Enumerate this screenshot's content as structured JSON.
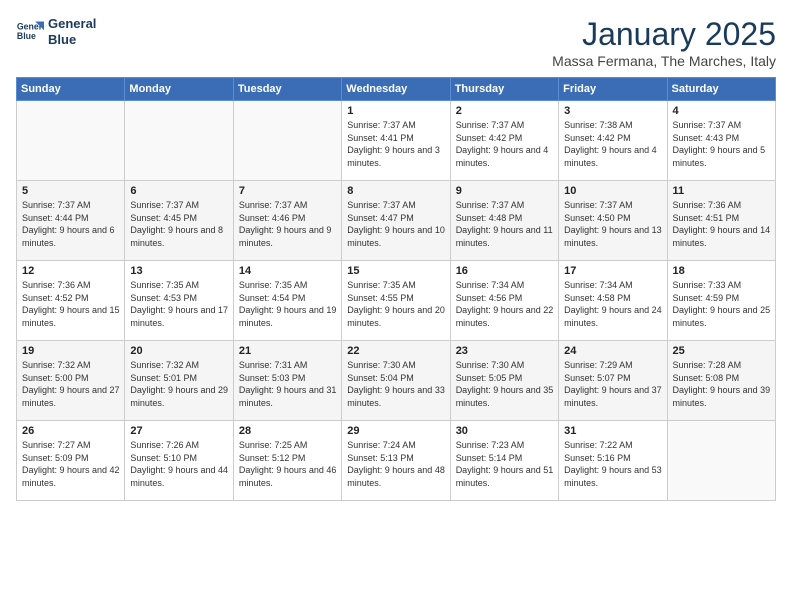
{
  "header": {
    "logo_line1": "General",
    "logo_line2": "Blue",
    "month": "January 2025",
    "location": "Massa Fermana, The Marches, Italy"
  },
  "weekdays": [
    "Sunday",
    "Monday",
    "Tuesday",
    "Wednesday",
    "Thursday",
    "Friday",
    "Saturday"
  ],
  "weeks": [
    [
      {
        "day": "",
        "info": ""
      },
      {
        "day": "",
        "info": ""
      },
      {
        "day": "",
        "info": ""
      },
      {
        "day": "1",
        "info": "Sunrise: 7:37 AM\nSunset: 4:41 PM\nDaylight: 9 hours and 3 minutes."
      },
      {
        "day": "2",
        "info": "Sunrise: 7:37 AM\nSunset: 4:42 PM\nDaylight: 9 hours and 4 minutes."
      },
      {
        "day": "3",
        "info": "Sunrise: 7:38 AM\nSunset: 4:42 PM\nDaylight: 9 hours and 4 minutes."
      },
      {
        "day": "4",
        "info": "Sunrise: 7:37 AM\nSunset: 4:43 PM\nDaylight: 9 hours and 5 minutes."
      }
    ],
    [
      {
        "day": "5",
        "info": "Sunrise: 7:37 AM\nSunset: 4:44 PM\nDaylight: 9 hours and 6 minutes."
      },
      {
        "day": "6",
        "info": "Sunrise: 7:37 AM\nSunset: 4:45 PM\nDaylight: 9 hours and 8 minutes."
      },
      {
        "day": "7",
        "info": "Sunrise: 7:37 AM\nSunset: 4:46 PM\nDaylight: 9 hours and 9 minutes."
      },
      {
        "day": "8",
        "info": "Sunrise: 7:37 AM\nSunset: 4:47 PM\nDaylight: 9 hours and 10 minutes."
      },
      {
        "day": "9",
        "info": "Sunrise: 7:37 AM\nSunset: 4:48 PM\nDaylight: 9 hours and 11 minutes."
      },
      {
        "day": "10",
        "info": "Sunrise: 7:37 AM\nSunset: 4:50 PM\nDaylight: 9 hours and 13 minutes."
      },
      {
        "day": "11",
        "info": "Sunrise: 7:36 AM\nSunset: 4:51 PM\nDaylight: 9 hours and 14 minutes."
      }
    ],
    [
      {
        "day": "12",
        "info": "Sunrise: 7:36 AM\nSunset: 4:52 PM\nDaylight: 9 hours and 15 minutes."
      },
      {
        "day": "13",
        "info": "Sunrise: 7:35 AM\nSunset: 4:53 PM\nDaylight: 9 hours and 17 minutes."
      },
      {
        "day": "14",
        "info": "Sunrise: 7:35 AM\nSunset: 4:54 PM\nDaylight: 9 hours and 19 minutes."
      },
      {
        "day": "15",
        "info": "Sunrise: 7:35 AM\nSunset: 4:55 PM\nDaylight: 9 hours and 20 minutes."
      },
      {
        "day": "16",
        "info": "Sunrise: 7:34 AM\nSunset: 4:56 PM\nDaylight: 9 hours and 22 minutes."
      },
      {
        "day": "17",
        "info": "Sunrise: 7:34 AM\nSunset: 4:58 PM\nDaylight: 9 hours and 24 minutes."
      },
      {
        "day": "18",
        "info": "Sunrise: 7:33 AM\nSunset: 4:59 PM\nDaylight: 9 hours and 25 minutes."
      }
    ],
    [
      {
        "day": "19",
        "info": "Sunrise: 7:32 AM\nSunset: 5:00 PM\nDaylight: 9 hours and 27 minutes."
      },
      {
        "day": "20",
        "info": "Sunrise: 7:32 AM\nSunset: 5:01 PM\nDaylight: 9 hours and 29 minutes."
      },
      {
        "day": "21",
        "info": "Sunrise: 7:31 AM\nSunset: 5:03 PM\nDaylight: 9 hours and 31 minutes."
      },
      {
        "day": "22",
        "info": "Sunrise: 7:30 AM\nSunset: 5:04 PM\nDaylight: 9 hours and 33 minutes."
      },
      {
        "day": "23",
        "info": "Sunrise: 7:30 AM\nSunset: 5:05 PM\nDaylight: 9 hours and 35 minutes."
      },
      {
        "day": "24",
        "info": "Sunrise: 7:29 AM\nSunset: 5:07 PM\nDaylight: 9 hours and 37 minutes."
      },
      {
        "day": "25",
        "info": "Sunrise: 7:28 AM\nSunset: 5:08 PM\nDaylight: 9 hours and 39 minutes."
      }
    ],
    [
      {
        "day": "26",
        "info": "Sunrise: 7:27 AM\nSunset: 5:09 PM\nDaylight: 9 hours and 42 minutes."
      },
      {
        "day": "27",
        "info": "Sunrise: 7:26 AM\nSunset: 5:10 PM\nDaylight: 9 hours and 44 minutes."
      },
      {
        "day": "28",
        "info": "Sunrise: 7:25 AM\nSunset: 5:12 PM\nDaylight: 9 hours and 46 minutes."
      },
      {
        "day": "29",
        "info": "Sunrise: 7:24 AM\nSunset: 5:13 PM\nDaylight: 9 hours and 48 minutes."
      },
      {
        "day": "30",
        "info": "Sunrise: 7:23 AM\nSunset: 5:14 PM\nDaylight: 9 hours and 51 minutes."
      },
      {
        "day": "31",
        "info": "Sunrise: 7:22 AM\nSunset: 5:16 PM\nDaylight: 9 hours and 53 minutes."
      },
      {
        "day": "",
        "info": ""
      }
    ]
  ]
}
